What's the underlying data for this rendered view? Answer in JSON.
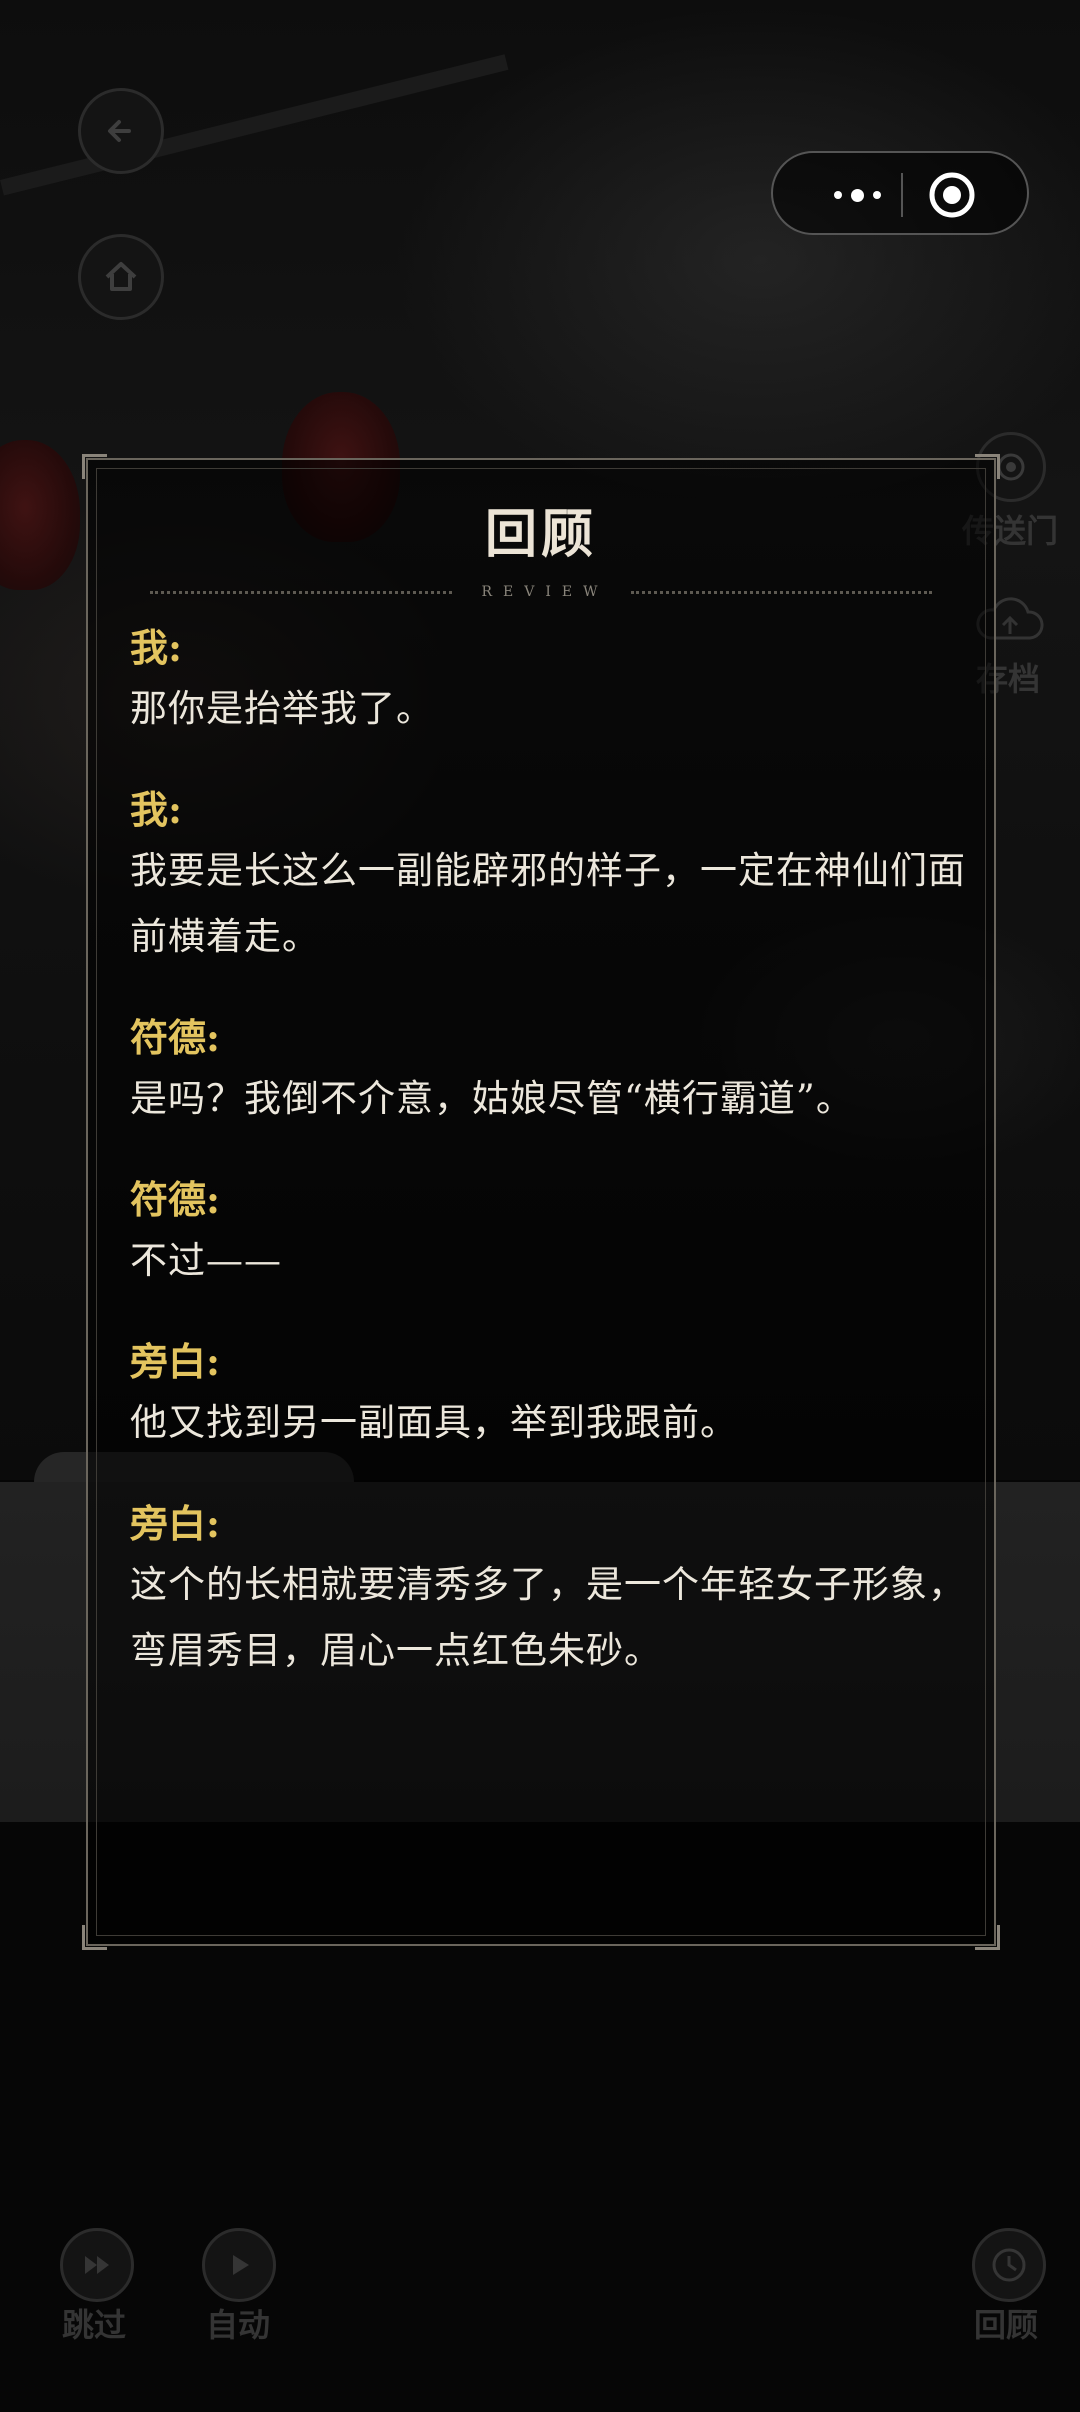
{
  "capsule": {
    "more_icon": "more-dots-icon",
    "close_icon": "target-close-icon"
  },
  "hud": {
    "back_icon": "back-arrow-icon",
    "home_icon": "home-icon",
    "portal_label": "传送门",
    "save_label": "存档",
    "skip_label": "跳过",
    "auto_label": "自动",
    "review_label": "回顾"
  },
  "review": {
    "title": "回顾",
    "subtitle": "REVIEW",
    "entries": [
      {
        "speaker": "我:",
        "text": "那你是抬举我了。"
      },
      {
        "speaker": "我:",
        "text": "我要是长这么一副能辟邪的样子，一定在神仙们面前横着走。"
      },
      {
        "speaker": "符德:",
        "text": "是吗？我倒不介意，姑娘尽管“横行霸道”。"
      },
      {
        "speaker": "符德:",
        "text": "不过——"
      },
      {
        "speaker": "旁白:",
        "text": "他又找到另一副面具，举到我跟前。"
      },
      {
        "speaker": "旁白:",
        "text": "这个的长相就要清秀多了，是一个年轻女子形象，弯眉秀目，眉心一点红色朱砂。"
      }
    ]
  },
  "colors": {
    "speaker": "#e3c45f",
    "text": "#ece7dc",
    "panel_border": "#6a655c"
  }
}
